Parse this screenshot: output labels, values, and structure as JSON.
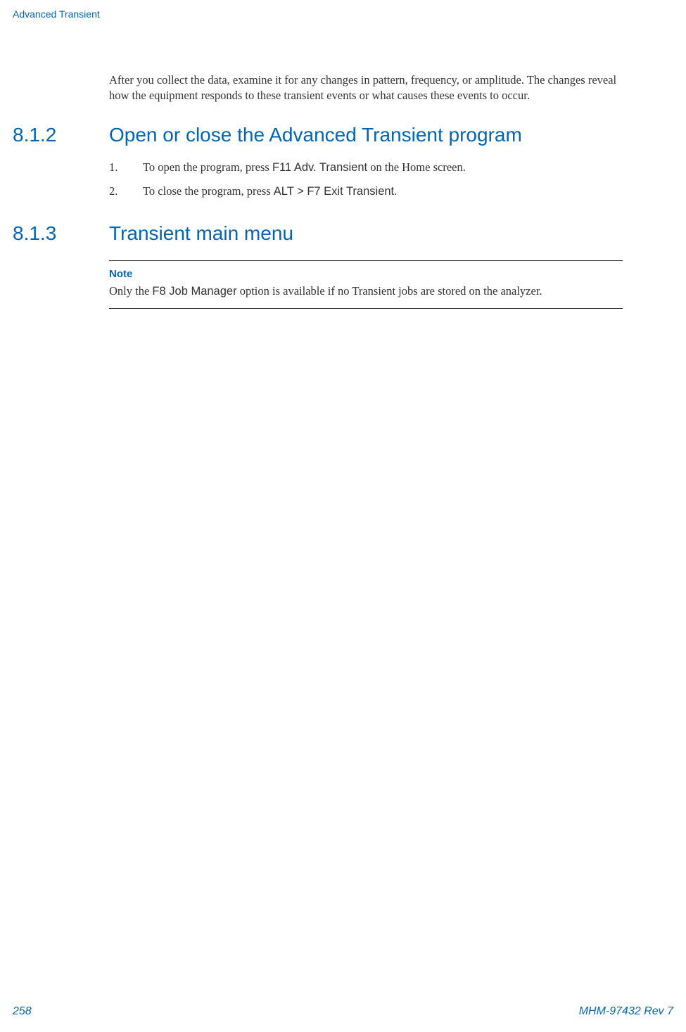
{
  "header": {
    "section_name": "Advanced Transient"
  },
  "intro": {
    "paragraph": "After you collect the data, examine it for any changes in pattern, frequency, or amplitude. The changes reveal how the equipment responds to these transient events or what causes these events to occur."
  },
  "section_812": {
    "number": "8.1.2",
    "title": "Open or close the Advanced Transient program",
    "steps": [
      {
        "num": "1.",
        "text_before": "To open the program, press ",
        "key": "F11 Adv. Transient",
        "text_after": " on the Home screen."
      },
      {
        "num": "2.",
        "text_before": "To close the program, press ",
        "key": "ALT > F7 Exit Transient",
        "text_after": "."
      }
    ]
  },
  "section_813": {
    "number": "8.1.3",
    "title": "Transient main menu",
    "note_label": "Note",
    "note_before": "Only the ",
    "note_key": "F8 Job Manager",
    "note_after": " option is available if no Transient jobs are stored on the analyzer."
  },
  "footer": {
    "page": "258",
    "doc_ref": "MHM-97432 Rev 7"
  }
}
